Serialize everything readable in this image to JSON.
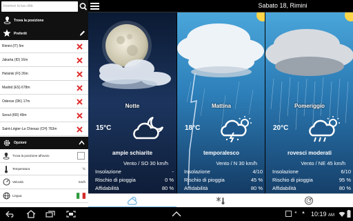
{
  "search": {
    "placeholder": "Inserisci la tua città",
    "icon": "search-icon"
  },
  "side": {
    "find_location": "Trova la posizione",
    "favorites": "Preferiti",
    "cities": [
      {
        "name": "Rimini (IT) 5m"
      },
      {
        "name": "Jakarta (ID) 16m"
      },
      {
        "name": "Helsinki (FI) 26m"
      },
      {
        "name": "Madrid (ES) 678m"
      },
      {
        "name": "Odense (DK) 17m"
      },
      {
        "name": "Seoul (KR) 49m"
      },
      {
        "name": "Saint-Légier-La Chiesaz (CH) 763m"
      }
    ],
    "options": "Opzioni",
    "opt_find_on_start": "Trova la posizione all'avvio",
    "opt_temperature": "Temperatura",
    "opt_temperature_value": "°C",
    "opt_speed": "Velocità",
    "opt_speed_value": "km/h",
    "opt_language": "Lingua"
  },
  "header": {
    "date": "Sabato 18, Rimini"
  },
  "labels": {
    "insolazione": "Insolazione",
    "pioggia": "Rischio di pioggia",
    "affidabilita": "Affidabilità"
  },
  "panels": [
    {
      "period": "Notte",
      "temp": "15°C",
      "desc": "ampie schiarite",
      "wind": "Vento / SO 30 km/h",
      "insolazione": "-",
      "pioggia": "0 %",
      "affidabilita": "80 %"
    },
    {
      "period": "Mattina",
      "temp": "18°C",
      "desc": "temporalesco",
      "wind": "Vento / N 30 km/h",
      "insolazione": "4/10",
      "pioggia": "45 %",
      "affidabilita": "80 %"
    },
    {
      "period": "Pomeriggio",
      "temp": "20°C",
      "desc": "rovesci moderati",
      "wind": "Vento / NE 45 km/h",
      "insolazione": "6/10",
      "pioggia": "95 %",
      "affidabilita": "80 %"
    }
  ],
  "tabs": [
    {
      "icon": "weather-icon"
    },
    {
      "icon": "snow-thermometer-icon"
    },
    {
      "icon": "radar-icon"
    }
  ],
  "status": {
    "time": "10:19",
    "ampm": "AM"
  },
  "colors": {
    "night_sky": "#0f1f3a",
    "day_sky": "#2f8bc4",
    "accent": "#6ab0e0",
    "delete": "#e03030"
  }
}
